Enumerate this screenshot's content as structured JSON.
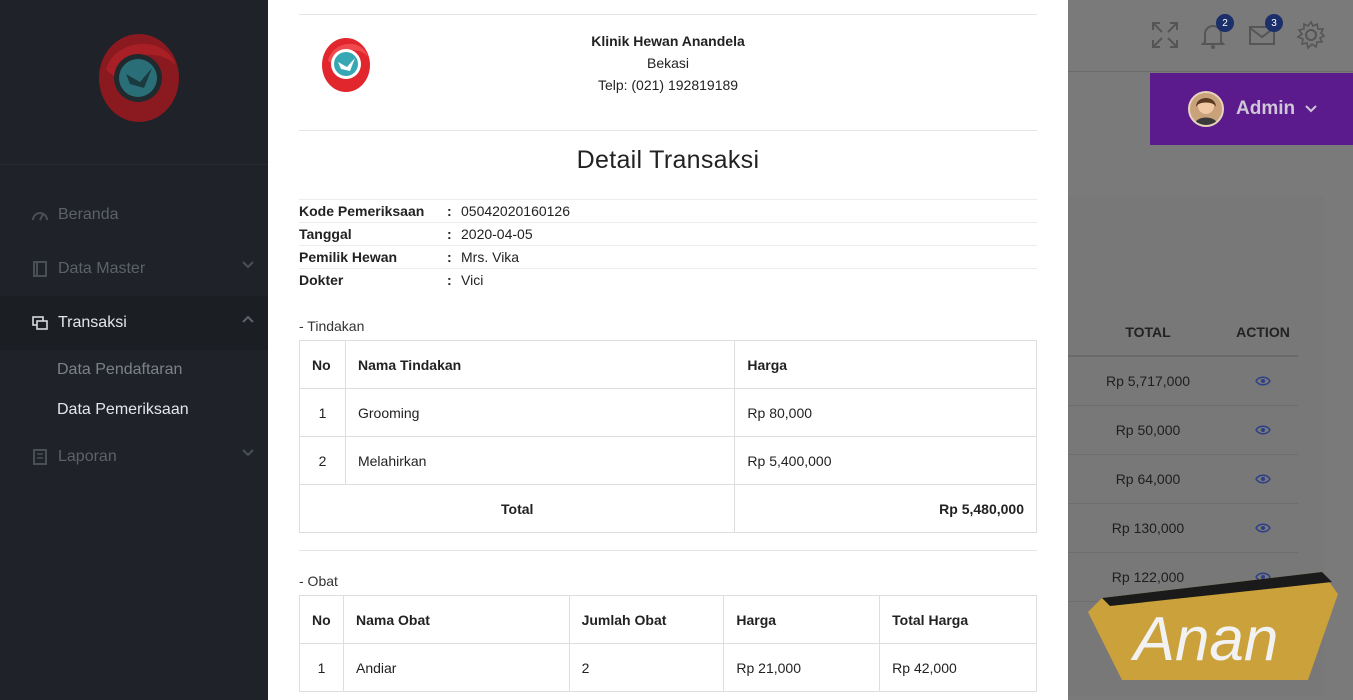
{
  "sidebar": {
    "items": [
      {
        "label": "Beranda",
        "icon": "dashboard-icon"
      },
      {
        "label": "Data Master",
        "icon": "book-icon"
      },
      {
        "label": "Transaksi",
        "icon": "copy-icon"
      },
      {
        "label": "Laporan",
        "icon": "report-icon"
      }
    ],
    "sub_items": [
      "Data Pendaftaran",
      "Data Pemeriksaan"
    ]
  },
  "header": {
    "notifications_count": "2",
    "messages_count": "3",
    "user_name": "Admin"
  },
  "background_table": {
    "columns": [
      "TOTAL",
      "ACTION"
    ],
    "rows": [
      "Rp 5,717,000",
      "Rp 50,000",
      "Rp 64,000",
      "Rp 130,000",
      "Rp 122,000"
    ]
  },
  "watermark": "Anan",
  "modal": {
    "clinic_name": "Klinik Hewan Anandela",
    "clinic_city": "Bekasi",
    "clinic_phone": "Telp: (021) 192819189",
    "title": "Detail Transaksi",
    "info": [
      {
        "label": "Kode Pemeriksaan",
        "value": "05042020160126"
      },
      {
        "label": "Tanggal",
        "value": "2020-04-05"
      },
      {
        "label": "Pemilik Hewan",
        "value": "Mrs. Vika"
      },
      {
        "label": "Dokter",
        "value": "Vici"
      }
    ],
    "colon": ":",
    "tindakan": {
      "section_label": "- Tindakan",
      "headers": [
        "No",
        "Nama Tindakan",
        "Harga"
      ],
      "rows": [
        {
          "no": "1",
          "name": "Grooming",
          "price": "Rp 80,000"
        },
        {
          "no": "2",
          "name": "Melahirkan",
          "price": "Rp 5,400,000"
        }
      ],
      "total_label": "Total",
      "total_value": "Rp 5,480,000"
    },
    "obat": {
      "section_label": "- Obat",
      "headers": [
        "No",
        "Nama Obat",
        "Jumlah Obat",
        "Harga",
        "Total Harga"
      ],
      "rows": [
        {
          "no": "1",
          "name": "Andiar",
          "qty": "2",
          "price": "Rp 21,000",
          "total": "Rp 42,000"
        }
      ]
    }
  },
  "colors": {
    "sidebar_bg": "#1f2228",
    "overlay_bg": "#7a7a7a",
    "user_bar": "#5c1b8c",
    "logo_red": "#c8202a",
    "logo_teal": "#2a8c95",
    "watermark_gold": "#caa13a"
  }
}
